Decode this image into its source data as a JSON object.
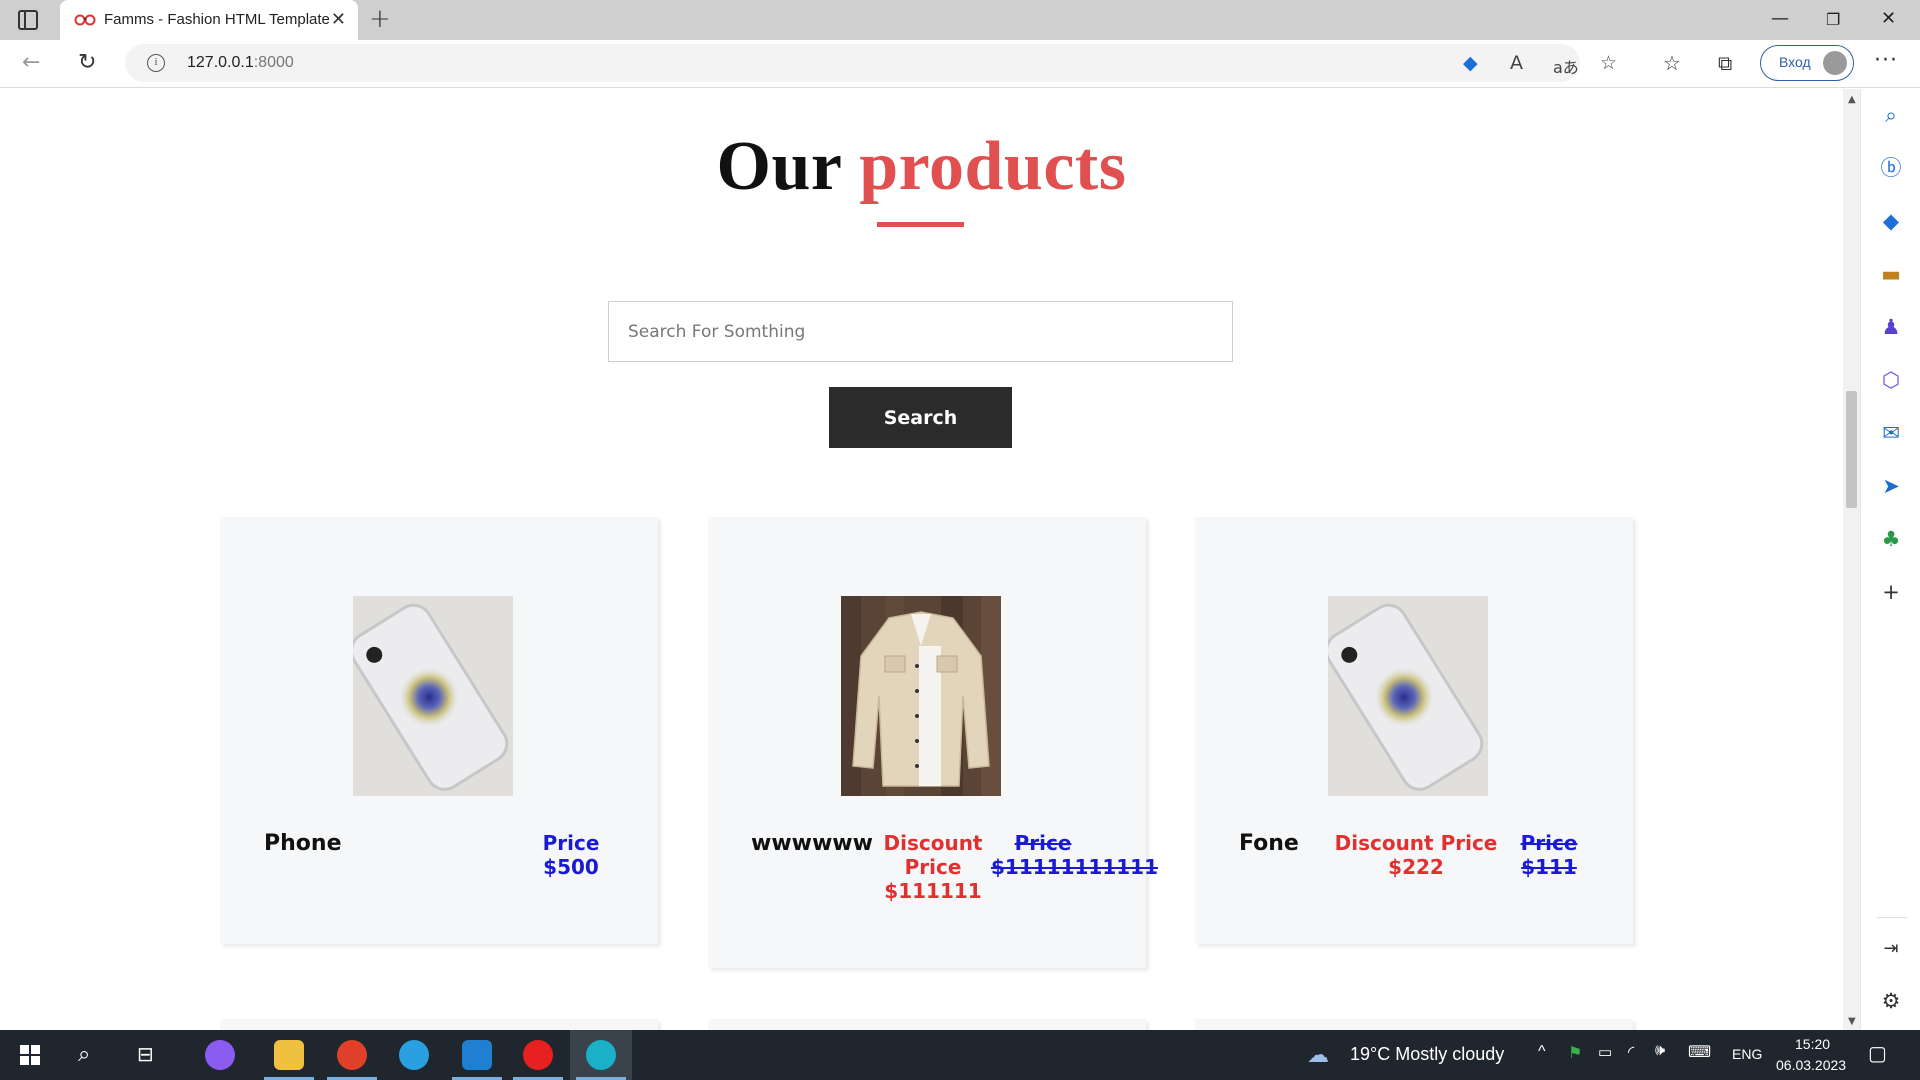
{
  "browser": {
    "tab_title": "Famms - Fashion HTML Template",
    "url_host": "127.0.0.1",
    "url_port": ":8000",
    "signin_label": "Вход"
  },
  "page": {
    "heading_word1": "Our",
    "heading_word2": "products",
    "search_placeholder": "Search For Somthing",
    "search_button": "Search",
    "products": [
      {
        "name": "Phone",
        "image": "phone",
        "price_label": "Price",
        "price_value": "$500"
      },
      {
        "name": "wwwwww",
        "image": "jacket",
        "discount_label_1": "Discount",
        "discount_label_2": "Price",
        "discount_value": "$111111",
        "old_price_label": "Price",
        "old_price_value": "$11111111111"
      },
      {
        "name": "Fone",
        "image": "phone",
        "discount_label": "Discount Price",
        "discount_value": "$222",
        "old_price_label": "Price",
        "old_price_value": "$111"
      }
    ]
  },
  "taskbar": {
    "weather": "19°C  Mostly cloudy",
    "language": "ENG",
    "time": "15:20",
    "date": "06.03.2023"
  },
  "colors": {
    "accent_red": "#e05050",
    "price_blue": "#1a1ad6",
    "discount_red": "#e03030"
  }
}
